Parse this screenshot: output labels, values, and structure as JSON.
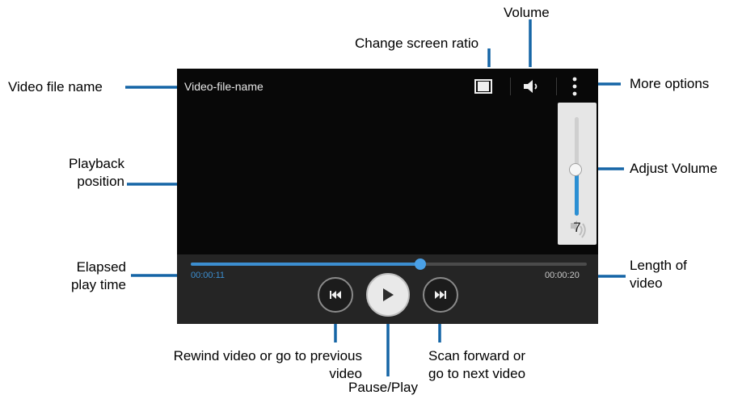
{
  "labels": {
    "volume": "Volume",
    "change_screen_ratio": "Change screen ratio",
    "video_file_name": "Video file name",
    "more_options": "More options",
    "playback_position": [
      "Playback",
      "position"
    ],
    "adjust_volume": "Adjust Volume",
    "elapsed_play_time": [
      "Elapsed",
      "play time"
    ],
    "length_of_video": [
      "Length of",
      "video"
    ],
    "rewind": [
      "Rewind video or go to previous",
      "video"
    ],
    "scan_forward": [
      "Scan forward or",
      "go to next video"
    ],
    "pause_play": "Pause/Play"
  },
  "player": {
    "file_name": "Video-file-name",
    "elapsed_time": "00:00:11",
    "total_time": "00:00:20",
    "progress_fraction": 0.58,
    "volume_level": "7",
    "volume_fraction": 0.47,
    "icons": {
      "screen_ratio": "screen-ratio-icon",
      "volume": "speaker-icon",
      "more": "more-options-icon",
      "rewind": "rewind-icon",
      "play": "play-icon",
      "forward": "fast-forward-icon",
      "volume_panel": "speaker-waves-icon"
    }
  },
  "colors": {
    "leader_line": "#1565a6",
    "accent": "#3c8ed0",
    "screen_bg": "#080808",
    "controls_bg": "#252525"
  }
}
